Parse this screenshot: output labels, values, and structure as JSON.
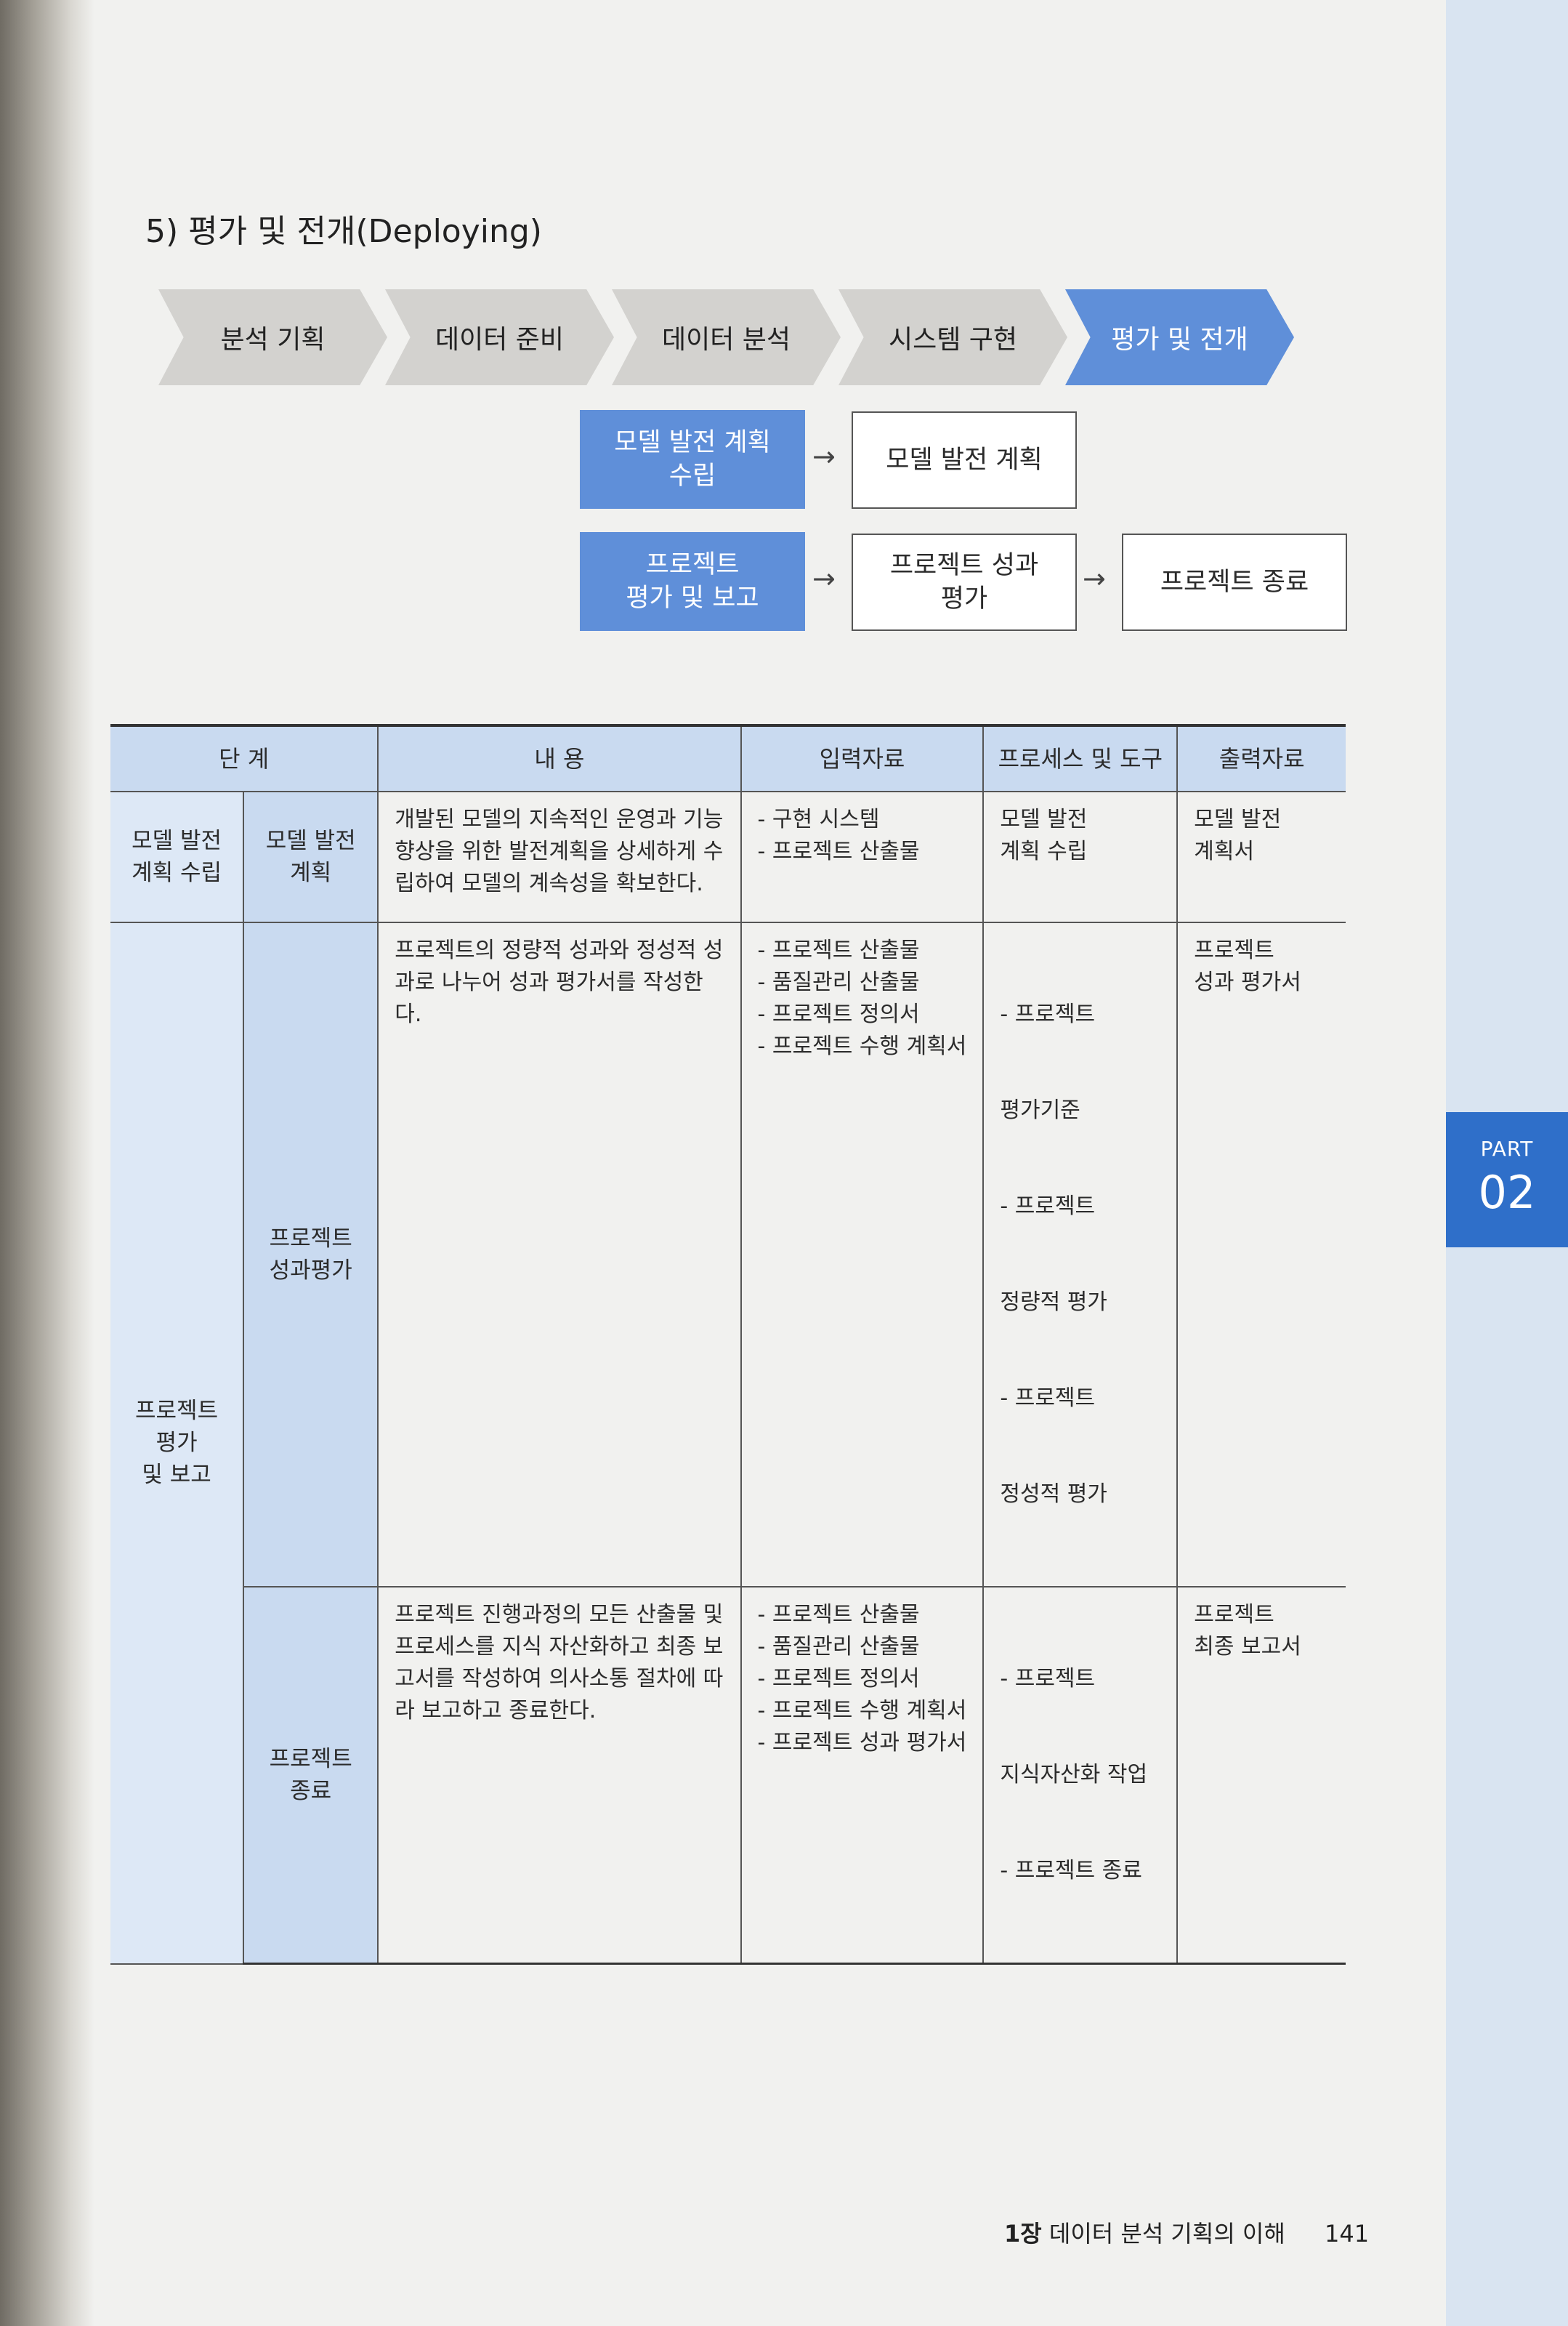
{
  "section_title": "5) 평가 및 전개(Deploying)",
  "flow": [
    "분석 기획",
    "데이터 준비",
    "데이터 분석",
    "시스템 구현",
    "평가 및 전개"
  ],
  "tasks": {
    "row1": {
      "task_lines": [
        "모델 발전 계획",
        "수립"
      ],
      "output": "모델 발전 계획"
    },
    "row2": {
      "task_lines": [
        "프로젝트",
        "평가 및 보고"
      ],
      "output1_lines": [
        "프로젝트 성과",
        "평가"
      ],
      "output2": "프로젝트 종료"
    },
    "arrow": "→"
  },
  "table": {
    "headers": [
      "단 계",
      "내 용",
      "입력자료",
      "프로세스 및 도구",
      "출력자료"
    ],
    "rows": [
      {
        "stage": [
          "모델 발전",
          "계획 수립"
        ],
        "substage": [
          "모델 발전",
          "계획"
        ],
        "content": "개발된 모델의 지속적인 운영과 기능 향상을 위한 발전계획을 상세하게 수립하여 모델의 계속성을 확보한다.",
        "inputs": [
          "- 구현 시스템",
          "- 프로젝트 산출물"
        ],
        "process": [
          "모델 발전",
          "계획 수립"
        ],
        "outputs": [
          "모델 발전",
          "계획서"
        ]
      },
      {
        "stage": [
          "프로젝트",
          "평가",
          "및 보고"
        ],
        "substage": [
          "프로젝트",
          "성과평가"
        ],
        "content": "프로젝트의 정량적 성과와 정성적 성과로 나누어 성과 평가서를 작성한다.",
        "inputs": [
          "- 프로젝트 산출물",
          "- 품질관리 산출물",
          "- 프로젝트 정의서",
          "- 프로젝트 수행 계획서"
        ],
        "process": [
          "- 프로젝트",
          "  평가기준",
          "- 프로젝트",
          "  정량적 평가",
          "- 프로젝트",
          "  정성적 평가"
        ],
        "outputs": [
          "프로젝트",
          "성과 평가서"
        ]
      },
      {
        "substage": [
          "프로젝트",
          "종료"
        ],
        "content": "프로젝트 진행과정의 모든 산출물 및 프로세스를 지식 자산화하고 최종 보고서를 작성하여 의사소통 절차에 따라 보고하고 종료한다.",
        "inputs": [
          "- 프로젝트 산출물",
          "- 품질관리 산출물",
          "- 프로젝트 정의서",
          "- 프로젝트 수행 계획서",
          "- 프로젝트 성과 평가서"
        ],
        "process": [
          "- 프로젝트",
          "  지식자산화 작업",
          "- 프로젝트 종료"
        ],
        "outputs": [
          "프로젝트",
          "최종 보고서"
        ]
      }
    ]
  },
  "part_tab": {
    "label": "PART",
    "number": "02"
  },
  "footer": {
    "chapter": "1장",
    "title": "데이터 분석 기획의 이해",
    "page": "141"
  }
}
